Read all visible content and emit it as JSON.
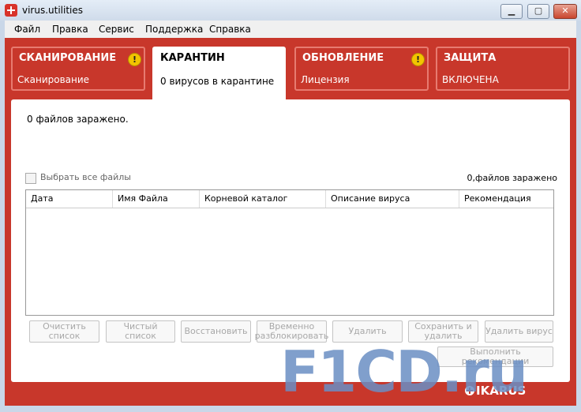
{
  "window": {
    "title": "virus.utilities",
    "minimize": "▁",
    "maximize": "▢",
    "close": "✕"
  },
  "menu": [
    "Файл",
    "Правка",
    "Сервис",
    "Поддержка",
    "Справка"
  ],
  "tabs": {
    "scan": {
      "title": "СКАНИРОВАНИЕ",
      "subtitle": "Сканирование",
      "warning": "!"
    },
    "quarantine": {
      "title": "КАРАНТИН",
      "subtitle": "0 вирусов в карантине"
    },
    "update": {
      "title": "ОБНОВЛЕНИЕ",
      "subtitle": "Лицензия",
      "warning": "!"
    },
    "protection": {
      "title": "ЗАЩИТА",
      "subtitle": "ВКЛЮЧЕНА"
    }
  },
  "content": {
    "infected_text": "0 файлов заражено.",
    "select_all_label": "Выбрать все файлы",
    "count_right": "0,файлов заражено",
    "columns": [
      "Дата",
      "Имя Файла",
      "Корневой каталог",
      "Описание вируса",
      "Рекомендация"
    ]
  },
  "buttons": {
    "clear_list": "Очистить список",
    "clean_list": "Чистый список",
    "restore": "Восстановить",
    "temp_unblock": "Временно разблокировать",
    "delete": "Удалить",
    "save_delete": "Сохранить и удалить",
    "delete_virus": "Удалить вирус",
    "apply_recommendations": "Выполнить рекомендации"
  },
  "brand": {
    "logo": "IKARUS",
    "watermark": "F1CD.ru"
  }
}
